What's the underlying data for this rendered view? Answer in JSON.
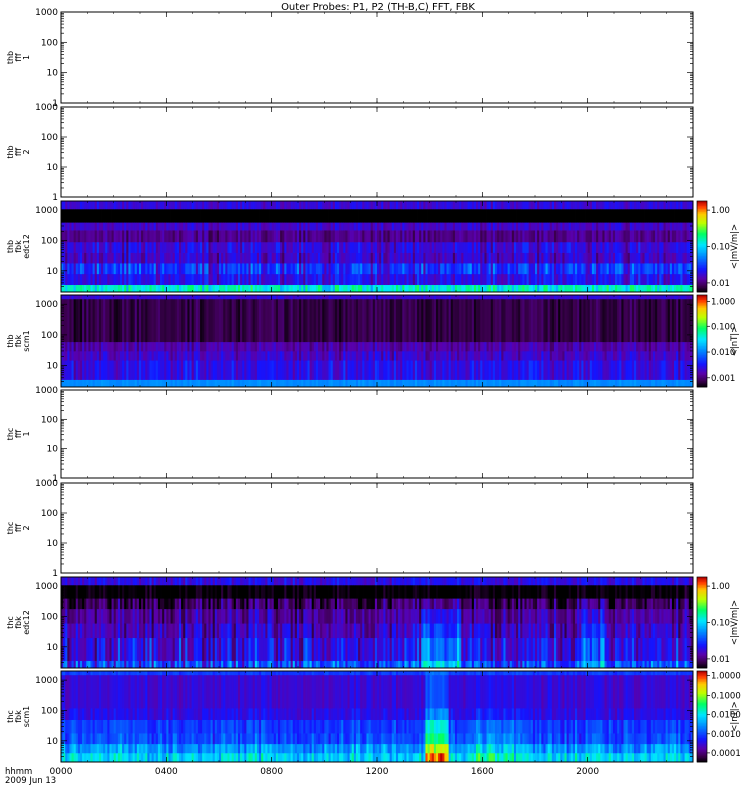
{
  "title": "Outer Probes: P1, P2 (TH-B,C) FFT, FBK",
  "time_axis": {
    "label_line1": "hhmm",
    "label_line2": "2009 Jun 13",
    "ticks": [
      "0000",
      "0400",
      "0800",
      "1200",
      "1600",
      "2000"
    ],
    "tick_hours": [
      0,
      4,
      8,
      12,
      16,
      20
    ],
    "range_hours": [
      0,
      24
    ]
  },
  "chart_data": [
    {
      "type": "heatmap",
      "panel_id": "thb-fff-1",
      "ylabel": [
        "thb",
        "fff",
        "1"
      ],
      "yscale": "log",
      "ylim": [
        1,
        1000
      ],
      "yticks": [
        "1000",
        "100",
        "10",
        "1"
      ],
      "ytick_values": [
        1000,
        100,
        10,
        1
      ],
      "has_data": false
    },
    {
      "type": "heatmap",
      "panel_id": "thb-fff-2",
      "ylabel": [
        "thb",
        "fff",
        "2"
      ],
      "yscale": "log",
      "ylim": [
        1,
        1000
      ],
      "yticks": [
        "1000",
        "100",
        "10",
        "1"
      ],
      "ytick_values": [
        1000,
        100,
        10,
        1
      ],
      "has_data": false
    },
    {
      "type": "heatmap",
      "panel_id": "thb-fbk-edc12",
      "ylabel": [
        "thb",
        "fbk",
        "edc12"
      ],
      "yscale": "log",
      "ylim": [
        2,
        2000
      ],
      "yticks": [
        "1000",
        "100",
        "10"
      ],
      "ytick_values": [
        1000,
        100,
        10
      ],
      "has_data": true,
      "colorbar": {
        "label": "<|mV/m|>",
        "ticks": [
          "1.00",
          "0.10",
          "0.01"
        ],
        "tick_fractions": [
          0.9,
          0.5,
          0.1
        ]
      },
      "bands": [
        {
          "lo": 2,
          "hi": 3.5,
          "base": 0.55,
          "var": 0.1
        },
        {
          "lo": 3.5,
          "hi": 8,
          "base": 0.22,
          "var": 0.08
        },
        {
          "lo": 8,
          "hi": 18,
          "base": 0.28,
          "var": 0.12
        },
        {
          "lo": 18,
          "hi": 40,
          "base": 0.18,
          "var": 0.08
        },
        {
          "lo": 40,
          "hi": 90,
          "base": 0.2,
          "var": 0.08
        },
        {
          "lo": 90,
          "hi": 220,
          "base": 0.12,
          "var": 0.05
        },
        {
          "lo": 220,
          "hi": 400,
          "base": 0.18,
          "var": 0.05
        },
        {
          "lo": 400,
          "hi": 1100,
          "base": 0.0,
          "var": 0.0
        },
        {
          "lo": 1100,
          "hi": 2000,
          "base": 0.2,
          "var": 0.05
        }
      ],
      "events": []
    },
    {
      "type": "heatmap",
      "panel_id": "thb-fbk-scm1",
      "ylabel": [
        "thb",
        "fbk",
        "scm1"
      ],
      "yscale": "log",
      "ylim": [
        2,
        2000
      ],
      "yticks": [
        "1000",
        "100",
        "10"
      ],
      "ytick_values": [
        1000,
        100,
        10
      ],
      "has_data": true,
      "colorbar": {
        "label": "<|nT|>",
        "ticks": [
          "1.000",
          "0.100",
          "0.010",
          "0.001"
        ],
        "tick_fractions": [
          0.93,
          0.66,
          0.38,
          0.1
        ]
      },
      "bands": [
        {
          "lo": 2,
          "hi": 3.5,
          "base": 0.4,
          "var": 0.02
        },
        {
          "lo": 3.5,
          "hi": 15,
          "base": 0.22,
          "var": 0.07
        },
        {
          "lo": 15,
          "hi": 30,
          "base": 0.18,
          "var": 0.06
        },
        {
          "lo": 30,
          "hi": 60,
          "base": 0.15,
          "var": 0.05
        },
        {
          "lo": 60,
          "hi": 1500,
          "base": 0.06,
          "var": 0.04
        },
        {
          "lo": 1500,
          "hi": 2000,
          "base": 0.2,
          "var": 0.03
        }
      ],
      "events": []
    },
    {
      "type": "heatmap",
      "panel_id": "thc-fff-1",
      "ylabel": [
        "thc",
        "fff",
        "1"
      ],
      "yscale": "log",
      "ylim": [
        1,
        1000
      ],
      "yticks": [
        "1000",
        "100",
        "10",
        "1"
      ],
      "ytick_values": [
        1000,
        100,
        10,
        1
      ],
      "has_data": false
    },
    {
      "type": "heatmap",
      "panel_id": "thc-fff-2",
      "ylabel": [
        "thc",
        "fff",
        "2"
      ],
      "yscale": "log",
      "ylim": [
        1,
        1000
      ],
      "yticks": [
        "1000",
        "100",
        "10",
        "1"
      ],
      "ytick_values": [
        1000,
        100,
        10,
        1
      ],
      "has_data": false
    },
    {
      "type": "heatmap",
      "panel_id": "thc-fbk-edc12",
      "ylabel": [
        "thc",
        "fbk",
        "edc12"
      ],
      "yscale": "log",
      "ylim": [
        2,
        2000
      ],
      "yticks": [
        "1000",
        "100",
        "10"
      ],
      "ytick_values": [
        1000,
        100,
        10
      ],
      "has_data": true,
      "colorbar": {
        "label": "<|mV/m|>",
        "ticks": [
          "1.00",
          "0.10",
          "0.01"
        ],
        "tick_fractions": [
          0.9,
          0.5,
          0.1
        ]
      },
      "bands": [
        {
          "lo": 2,
          "hi": 3.5,
          "base": 0.32,
          "var": 0.15
        },
        {
          "lo": 3.5,
          "hi": 20,
          "base": 0.22,
          "var": 0.12
        },
        {
          "lo": 20,
          "hi": 60,
          "base": 0.18,
          "var": 0.1
        },
        {
          "lo": 60,
          "hi": 180,
          "base": 0.14,
          "var": 0.08
        },
        {
          "lo": 180,
          "hi": 400,
          "base": 0.08,
          "var": 0.1
        },
        {
          "lo": 400,
          "hi": 1100,
          "base": 0.0,
          "var": 0.05
        },
        {
          "lo": 1100,
          "hi": 2000,
          "base": 0.22,
          "var": 0.06
        }
      ],
      "events": [
        {
          "from": 13.7,
          "to": 15.2,
          "boost": 0.22
        },
        {
          "from": 19.8,
          "to": 20.6,
          "boost": 0.15
        }
      ]
    },
    {
      "type": "heatmap",
      "panel_id": "thc-fbk-scm1",
      "ylabel": [
        "thc",
        "fbk",
        "scm1"
      ],
      "yscale": "log",
      "ylim": [
        2,
        2000
      ],
      "yticks": [
        "1000",
        "100",
        "10"
      ],
      "ytick_values": [
        1000,
        100,
        10
      ],
      "has_data": true,
      "colorbar": {
        "label": "<|nT|>",
        "ticks": [
          "1.0000",
          "0.1000",
          "0.0100",
          "0.0010",
          "0.0001"
        ],
        "tick_fractions": [
          0.95,
          0.73,
          0.52,
          0.31,
          0.1
        ]
      },
      "bands": [
        {
          "lo": 2,
          "hi": 4,
          "base": 0.5,
          "var": 0.1
        },
        {
          "lo": 4,
          "hi": 8,
          "base": 0.42,
          "var": 0.1
        },
        {
          "lo": 8,
          "hi": 18,
          "base": 0.32,
          "var": 0.08
        },
        {
          "lo": 18,
          "hi": 50,
          "base": 0.3,
          "var": 0.06
        },
        {
          "lo": 50,
          "hi": 120,
          "base": 0.22,
          "var": 0.05
        },
        {
          "lo": 120,
          "hi": 1500,
          "base": 0.2,
          "var": 0.04
        },
        {
          "lo": 1500,
          "hi": 2000,
          "base": 0.3,
          "var": 0.03
        }
      ],
      "events": [
        {
          "from": 13.8,
          "to": 14.7,
          "boost": 0.4
        },
        {
          "from": 15.6,
          "to": 17.2,
          "boost": 0.12
        }
      ]
    }
  ]
}
